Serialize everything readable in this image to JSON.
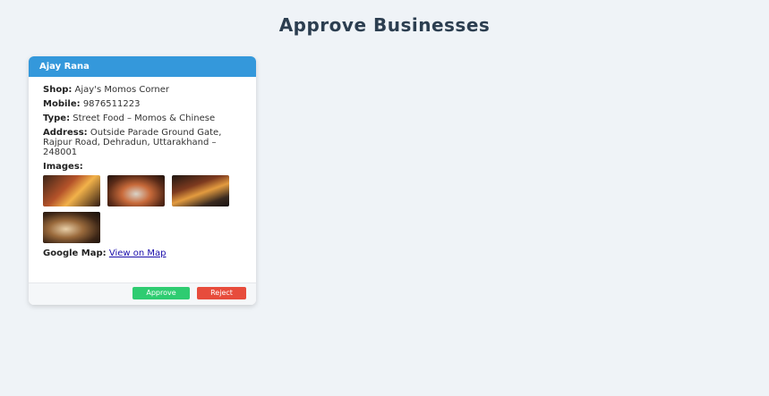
{
  "page": {
    "title": "Approve Businesses"
  },
  "business_card": {
    "owner_name": "Ajay Rana",
    "shop_label": "Shop:",
    "shop_value": "Ajay's Momos Corner",
    "mobile_label": "Mobile:",
    "mobile_value": "9876511223",
    "type_label": "Type:",
    "type_value": "Street Food – Momos & Chinese",
    "address_label": "Address:",
    "address_value": "Outside Parade Ground Gate, Rajpur Road, Dehradun, Uttarakhand – 248001",
    "images_label": "Images:",
    "map_label": "Google Map:",
    "map_link_text": "View on Map",
    "approve_label": "Approve",
    "reject_label": "Reject"
  },
  "colors": {
    "header": "#3498db",
    "approve": "#2ecc71",
    "reject": "#e74c3c",
    "background": "#eff3f7"
  }
}
